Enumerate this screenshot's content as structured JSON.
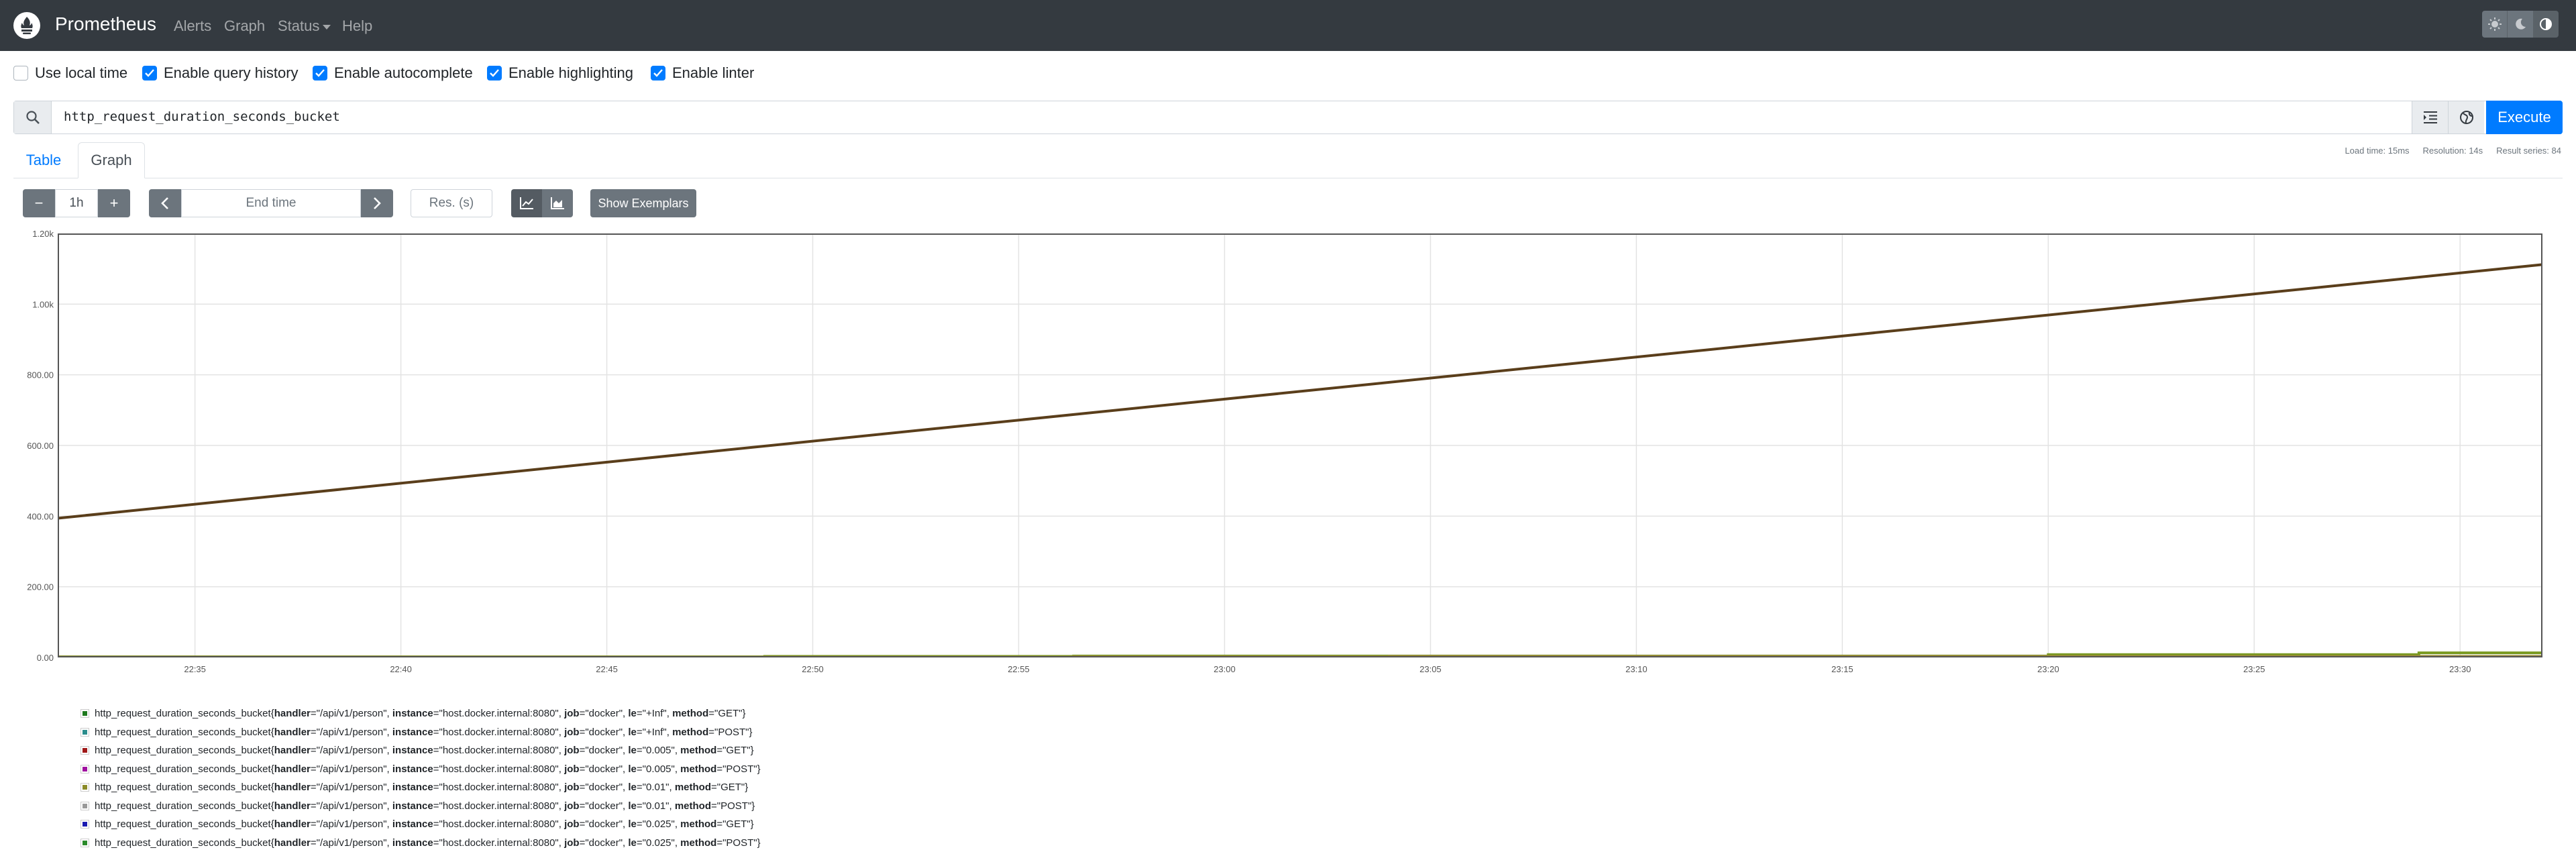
{
  "navbar": {
    "brand": "Prometheus",
    "items": [
      "Alerts",
      "Graph",
      "Status",
      "Help"
    ],
    "theme_buttons": [
      "sun-icon",
      "moon-icon",
      "half-circle-icon"
    ]
  },
  "options": [
    {
      "label": "Use local time",
      "checked": false
    },
    {
      "label": "Enable query history",
      "checked": true
    },
    {
      "label": "Enable autocomplete",
      "checked": true
    },
    {
      "label": "Enable highlighting",
      "checked": true
    },
    {
      "label": "Enable linter",
      "checked": true
    }
  ],
  "expression": {
    "value": "http_request_duration_seconds_bucket",
    "execute_label": "Execute"
  },
  "tabs": {
    "table": "Table",
    "graph": "Graph"
  },
  "stats": {
    "load_time": "Load time: 15ms",
    "resolution": "Resolution: 14s",
    "result_series": "Result series: 84"
  },
  "controls": {
    "minus": "−",
    "range": "1h",
    "plus": "+",
    "end_time_placeholder": "End time",
    "res_placeholder": "Res. (s)",
    "exemplars_label": "Show Exemplars"
  },
  "chart_data": {
    "type": "line",
    "title": "",
    "xlabel": "",
    "ylabel": "",
    "x_ticks": [
      "22:35",
      "22:40",
      "22:45",
      "22:50",
      "22:55",
      "23:00",
      "23:05",
      "23:10",
      "23:15",
      "23:20",
      "23:25",
      "23:30"
    ],
    "y_ticks": [
      "0.00",
      "200.00",
      "400.00",
      "600.00",
      "800.00",
      "1.00k",
      "1.20k"
    ],
    "ylim": [
      0,
      1200
    ],
    "grid": true,
    "series": [
      {
        "color": "#5a3e1b",
        "x_start": "22:31:40",
        "x_end": "23:32:00",
        "y_start": 394,
        "y_end": 1112
      },
      {
        "color": "#7a9a20",
        "steps": [
          [
            "22:31:40",
            2
          ],
          [
            "22:48:50",
            3
          ],
          [
            "22:56:20",
            4
          ],
          [
            "23:20:00",
            8
          ],
          [
            "23:29:00",
            13
          ],
          [
            "23:32:00",
            13
          ]
        ]
      },
      {
        "color": "#9b8a3a",
        "steps": [
          [
            "22:31:40",
            1
          ],
          [
            "22:56:20",
            2
          ],
          [
            "23:04:00",
            3
          ],
          [
            "23:32:00",
            5
          ]
        ]
      }
    ],
    "legend": [
      {
        "color": "#1f7a1f",
        "metric": "http_request_duration_seconds_bucket",
        "handler": "\"/api/v1/person\"",
        "instance": "\"host.docker.internal:8080\"",
        "job": "\"docker\"",
        "le": "\"+Inf\"",
        "method": "\"GET\""
      },
      {
        "color": "#2a8c8c",
        "metric": "http_request_duration_seconds_bucket",
        "handler": "\"/api/v1/person\"",
        "instance": "\"host.docker.internal:8080\"",
        "job": "\"docker\"",
        "le": "\"+Inf\"",
        "method": "\"POST\""
      },
      {
        "color": "#a01818",
        "metric": "http_request_duration_seconds_bucket",
        "handler": "\"/api/v1/person\"",
        "instance": "\"host.docker.internal:8080\"",
        "job": "\"docker\"",
        "le": "\"0.005\"",
        "method": "\"GET\""
      },
      {
        "color": "#a010a0",
        "metric": "http_request_duration_seconds_bucket",
        "handler": "\"/api/v1/person\"",
        "instance": "\"host.docker.internal:8080\"",
        "job": "\"docker\"",
        "le": "\"0.005\"",
        "method": "\"POST\""
      },
      {
        "color": "#8a8a28",
        "metric": "http_request_duration_seconds_bucket",
        "handler": "\"/api/v1/person\"",
        "instance": "\"host.docker.internal:8080\"",
        "job": "\"docker\"",
        "le": "\"0.01\"",
        "method": "\"GET\""
      },
      {
        "color": "#999999",
        "metric": "http_request_duration_seconds_bucket",
        "handler": "\"/api/v1/person\"",
        "instance": "\"host.docker.internal:8080\"",
        "job": "\"docker\"",
        "le": "\"0.01\"",
        "method": "\"POST\""
      },
      {
        "color": "#1a1ab0",
        "metric": "http_request_duration_seconds_bucket",
        "handler": "\"/api/v1/person\"",
        "instance": "\"host.docker.internal:8080\"",
        "job": "\"docker\"",
        "le": "\"0.025\"",
        "method": "\"GET\""
      },
      {
        "color": "#2a8a2a",
        "metric": "http_request_duration_seconds_bucket",
        "handler": "\"/api/v1/person\"",
        "instance": "\"host.docker.internal:8080\"",
        "job": "\"docker\"",
        "le": "\"0.025\"",
        "method": "\"POST\""
      }
    ]
  }
}
